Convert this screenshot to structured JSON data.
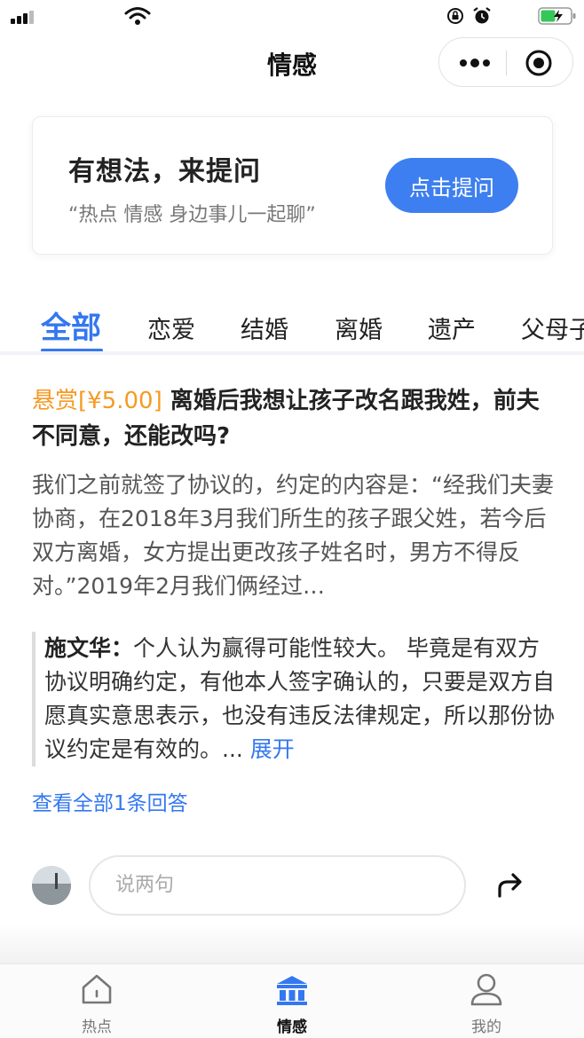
{
  "nav": {
    "title": "情感"
  },
  "ask_card": {
    "title": "有想法，来提问",
    "subtitle": "“热点 情感 身边事儿一起聊”",
    "button_label": "点击提问"
  },
  "tabs": [
    {
      "label": "全部",
      "active": true
    },
    {
      "label": "恋爱"
    },
    {
      "label": "结婚"
    },
    {
      "label": "离婚"
    },
    {
      "label": "遗产"
    },
    {
      "label": "父母子"
    }
  ],
  "post": {
    "bounty": "悬赏[¥5.00]",
    "title": "离婚后我想让孩子改名跟我姓，前夫不同意，还能改吗?",
    "body": "我们之前就签了协议的，约定的内容是：“经我们夫妻协商，在2018年3月我们所生的孩子跟父姓，若今后双方离婚，女方提出更改孩子姓名时，男方不得反对。”2019年2月我们俩经过…",
    "answer": {
      "author": "施文华：",
      "text": "个人认为赢得可能性较大。 毕竟是有双方协议明确约定，有他本人签字确认的，只要是双方自愿真实意思表示，也没有违反法律规定，所以那份协议约定是有效的。... ",
      "expand_label": "展开"
    },
    "view_all_label": "查看全部1条回答"
  },
  "comment": {
    "placeholder": "说两句"
  },
  "tabbar": [
    {
      "label": "热点",
      "icon": "home-icon"
    },
    {
      "label": "情感",
      "icon": "building-icon",
      "active": true
    },
    {
      "label": "我的",
      "icon": "user-icon"
    }
  ],
  "colors": {
    "accent": "#3478f0",
    "button": "#3d7ff0",
    "bounty": "#f59a23",
    "battery": "#35c759"
  }
}
